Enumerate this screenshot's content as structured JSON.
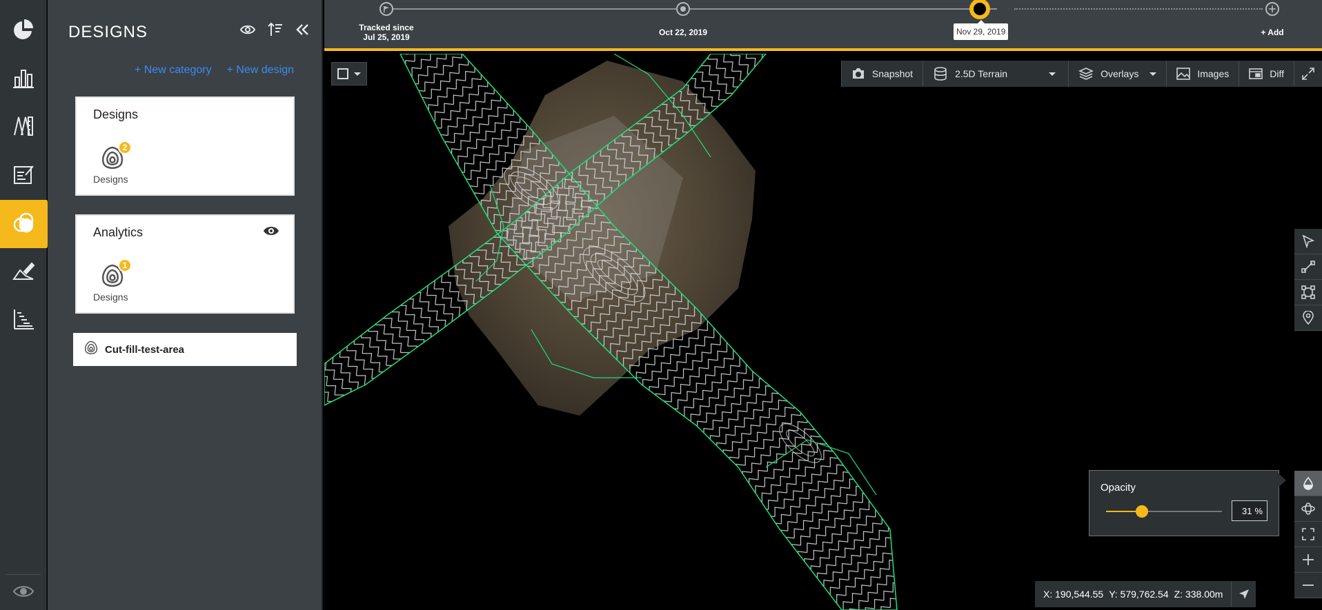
{
  "rail": {
    "items": [
      {
        "name": "dashboard",
        "icon": "pie-chart-icon"
      },
      {
        "name": "reports",
        "icon": "bar-chart-icon"
      },
      {
        "name": "measurements",
        "icon": "ruler-icon"
      },
      {
        "name": "notes",
        "icon": "edit-note-icon"
      },
      {
        "name": "designs",
        "icon": "overlap-circles-icon",
        "active": true
      },
      {
        "name": "annotate",
        "icon": "pen-surface-icon"
      },
      {
        "name": "progress",
        "icon": "gantt-icon"
      }
    ],
    "bottom_icon": "eye-icon"
  },
  "panel": {
    "title": "DESIGNS",
    "new_category": "+ New category",
    "new_design": "+ New design",
    "categories": [
      {
        "title": "Designs",
        "badge": "2",
        "chip_label": "Designs",
        "show_eye": false
      },
      {
        "title": "Analytics",
        "badge": "1",
        "chip_label": "Designs",
        "show_eye": true
      }
    ],
    "single_design": "Cut-fill-test-area"
  },
  "timeline": {
    "start_label_line1": "Tracked since",
    "start_label_line2": "Jul 25, 2019",
    "mid_label": "Oct 22, 2019",
    "current_label": "Nov 29, 2019",
    "add_label": "+ Add"
  },
  "toolbar": {
    "snapshot": "Snapshot",
    "terrain": "2.5D Terrain",
    "overlays": "Overlays",
    "images": "Images",
    "diff": "Diff"
  },
  "opacity": {
    "title": "Opacity",
    "value": "31",
    "unit": "%",
    "fraction": 0.31
  },
  "coords": {
    "x": "X: 190,544.55",
    "y": "Y: 579,762.54",
    "z": "Z: 338.00m"
  },
  "colors": {
    "accent": "#f5b91b",
    "link": "#3d8af7",
    "design_line": "#19e07f"
  }
}
